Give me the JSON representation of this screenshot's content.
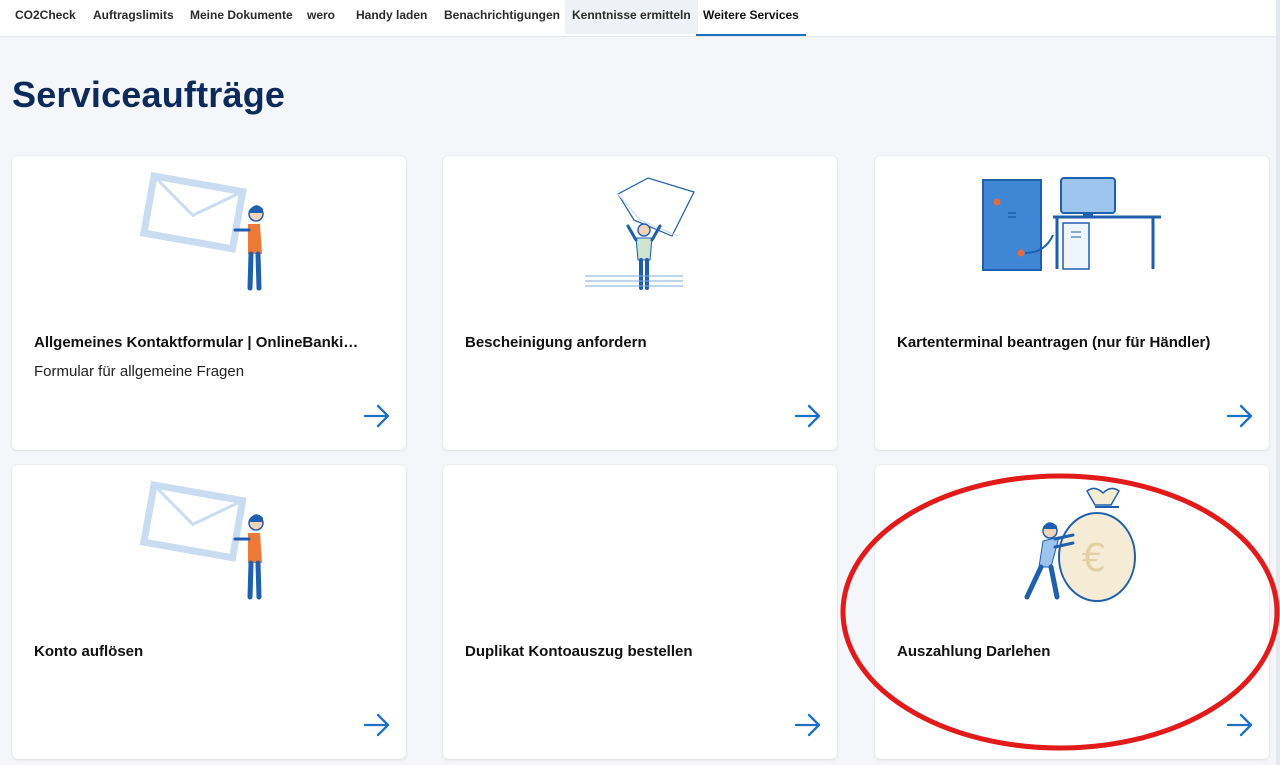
{
  "nav": {
    "tabs": [
      {
        "label": "CO2Check"
      },
      {
        "label": "Auftragslimits"
      },
      {
        "label": "Meine Dokumente"
      },
      {
        "label": "wero"
      },
      {
        "label": "Handy laden"
      },
      {
        "label": "Benachrichtigungen"
      },
      {
        "label": "Kenntnisse ermitteln"
      },
      {
        "label": "Weitere Services"
      }
    ],
    "active_tab": "Weitere Services"
  },
  "page": {
    "title": "Serviceaufträge"
  },
  "cards": [
    {
      "title": "Allgemeines Kontaktformular | OnlineBanking & ...",
      "subtitle": "Formular für allgemeine Fragen",
      "illustration": "envelope-person-illustration",
      "action_icon": "arrow-right-icon"
    },
    {
      "title": "Bescheinigung anfordern",
      "subtitle": "",
      "illustration": "document-person-illustration",
      "action_icon": "arrow-right-icon"
    },
    {
      "title": "Kartenterminal beantragen (nur für Händler)",
      "subtitle": "",
      "illustration": "computer-desk-illustration",
      "action_icon": "arrow-right-icon"
    },
    {
      "title": "Konto auflösen",
      "subtitle": "",
      "illustration": "envelope-person-illustration",
      "action_icon": "arrow-right-icon"
    },
    {
      "title": "Duplikat Kontoauszug bestellen",
      "subtitle": "",
      "illustration": "",
      "action_icon": "arrow-right-icon"
    },
    {
      "title": "Auszahlung Darlehen",
      "subtitle": "",
      "illustration": "money-bag-person-illustration",
      "action_icon": "arrow-right-icon",
      "highlighted": true
    }
  ],
  "colors": {
    "accent": "#1f6fc5",
    "title": "#0c2a5b",
    "highlight_ring": "#e21a1a",
    "background": "#f4f6f9"
  }
}
